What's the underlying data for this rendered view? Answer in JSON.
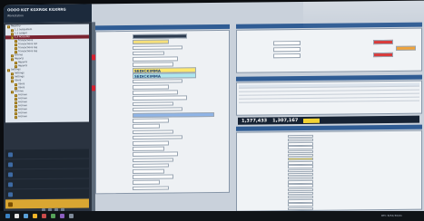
{
  "app": {
    "title": "OOOO KGT KGXRGK KGXRRG",
    "subtitle": "Workstation"
  },
  "tree": [
    {
      "label": "Registry",
      "indent": 0,
      "selected": false
    },
    {
      "label": "1.1 Subsystem",
      "indent": 1,
      "selected": false
    },
    {
      "label": "1.2 Ledger",
      "indent": 1,
      "selected": false
    },
    {
      "label": "1.3 Accounts",
      "indent": 1,
      "selected": true
    },
    {
      "label": "Transactions",
      "indent": 2,
      "selected": false
    },
    {
      "label": "Transactions list",
      "indent": 2,
      "selected": false
    },
    {
      "label": "Transactions log",
      "indent": 2,
      "selected": false
    },
    {
      "label": "Transactions log",
      "indent": 2,
      "selected": false
    },
    {
      "label": "Entries",
      "indent": 1,
      "selected": false
    },
    {
      "label": "Reports",
      "indent": 1,
      "selected": false
    },
    {
      "label": "Reports",
      "indent": 2,
      "selected": false
    },
    {
      "label": "Reports",
      "indent": 2,
      "selected": false
    },
    {
      "label": "Settings",
      "indent": 0,
      "selected": false
    },
    {
      "label": "Settings",
      "indent": 1,
      "selected": false
    },
    {
      "label": "Settings",
      "indent": 1,
      "selected": false
    },
    {
      "label": "Users",
      "indent": 1,
      "selected": false
    },
    {
      "label": "Users",
      "indent": 2,
      "selected": false
    },
    {
      "label": "Users",
      "indent": 2,
      "selected": false
    },
    {
      "label": "Archive",
      "indent": 1,
      "selected": false
    },
    {
      "label": "Archive",
      "indent": 2,
      "selected": false
    },
    {
      "label": "Archive",
      "indent": 2,
      "selected": false
    },
    {
      "label": "Archive",
      "indent": 2,
      "selected": false
    },
    {
      "label": "Archive",
      "indent": 2,
      "selected": false
    },
    {
      "label": "Archive",
      "indent": 2,
      "selected": false
    },
    {
      "label": "Archive",
      "indent": 2,
      "selected": false
    },
    {
      "label": "Archive",
      "indent": 2,
      "selected": false
    }
  ],
  "modules": [
    {
      "label": "",
      "icon": "folder-icon",
      "active": false
    },
    {
      "label": "",
      "icon": "document-icon",
      "active": false
    },
    {
      "label": "",
      "icon": "chart-icon",
      "active": false
    },
    {
      "label": "",
      "icon": "users-icon",
      "active": false
    },
    {
      "label": "",
      "icon": "gear-icon",
      "active": false
    },
    {
      "label": "",
      "icon": "star-icon",
      "active": true
    }
  ],
  "form": {
    "header": "",
    "rows": [
      {
        "label": "",
        "value": "",
        "style": "dark"
      },
      {
        "label": "",
        "value": "",
        "style": "yellow"
      },
      {
        "label": "",
        "value": "",
        "style": ""
      },
      {
        "label": "",
        "value": "",
        "style": ""
      },
      {
        "label": "",
        "value": "",
        "style": ""
      },
      {
        "label": "",
        "value": "",
        "style": ""
      },
      {
        "label": "",
        "value": "SEDICKIMMA",
        "style": "big highlight"
      },
      {
        "label": "",
        "value": "SEDICKIMMA",
        "style": "big cyan"
      },
      {
        "label": "",
        "value": "",
        "style": ""
      },
      {
        "label": "",
        "value": "",
        "style": ""
      },
      {
        "label": "",
        "value": "",
        "style": ""
      },
      {
        "label": "",
        "value": "",
        "style": ""
      },
      {
        "label": "",
        "value": "",
        "style": ""
      },
      {
        "label": "",
        "value": "",
        "style": ""
      },
      {
        "label": "",
        "value": "",
        "style": "blue"
      },
      {
        "label": "",
        "value": "",
        "style": ""
      },
      {
        "label": "",
        "value": "",
        "style": ""
      },
      {
        "label": "",
        "value": "",
        "style": ""
      },
      {
        "label": "",
        "value": "",
        "style": ""
      },
      {
        "label": "",
        "value": "",
        "style": ""
      },
      {
        "label": "",
        "value": "",
        "style": ""
      },
      {
        "label": "",
        "value": "",
        "style": ""
      },
      {
        "label": "",
        "value": "",
        "style": ""
      },
      {
        "label": "",
        "value": "",
        "style": ""
      },
      {
        "label": "",
        "value": "",
        "style": ""
      },
      {
        "label": "",
        "value": "",
        "style": ""
      },
      {
        "label": "",
        "value": "",
        "style": ""
      },
      {
        "label": "",
        "value": "",
        "style": ""
      }
    ]
  },
  "right_top": {
    "header": "",
    "fields": [
      {
        "label": "",
        "value": ""
      },
      {
        "label": "",
        "value": ""
      },
      {
        "label": "",
        "value": ""
      }
    ],
    "chips": [
      "",
      "",
      ""
    ]
  },
  "right_mid": {
    "header": "",
    "rows": [
      [
        "",
        "",
        "",
        ""
      ],
      [
        "",
        "",
        "",
        ""
      ],
      [
        "",
        "",
        "",
        ""
      ],
      [
        "",
        "",
        "",
        ""
      ],
      [
        "",
        "",
        "",
        ""
      ]
    ]
  },
  "totals": {
    "value1": "1,377,433",
    "value2": "1,307,167"
  },
  "right_bottom": {
    "header": "",
    "rows": [
      [
        "",
        ""
      ],
      [
        "",
        ""
      ],
      [
        "",
        ""
      ],
      [
        "",
        ""
      ],
      [
        "",
        ""
      ],
      [
        "",
        ""
      ],
      [
        "",
        ""
      ],
      [
        "",
        ""
      ],
      [
        "",
        ""
      ],
      [
        "",
        ""
      ],
      [
        "",
        ""
      ],
      [
        "",
        ""
      ],
      [
        "",
        ""
      ],
      [
        "",
        ""
      ],
      [
        "",
        ""
      ],
      [
        "",
        ""
      ],
      [
        "",
        ""
      ],
      [
        "",
        ""
      ],
      [
        "",
        ""
      ],
      [
        "",
        ""
      ]
    ]
  },
  "taskbar": {
    "clock": "RTC 8/32/30/01"
  },
  "colors": {
    "accent": "#2f5c94",
    "selection": "#7a2331",
    "highlight": "#ffe86d",
    "alert": "#d6212f"
  }
}
